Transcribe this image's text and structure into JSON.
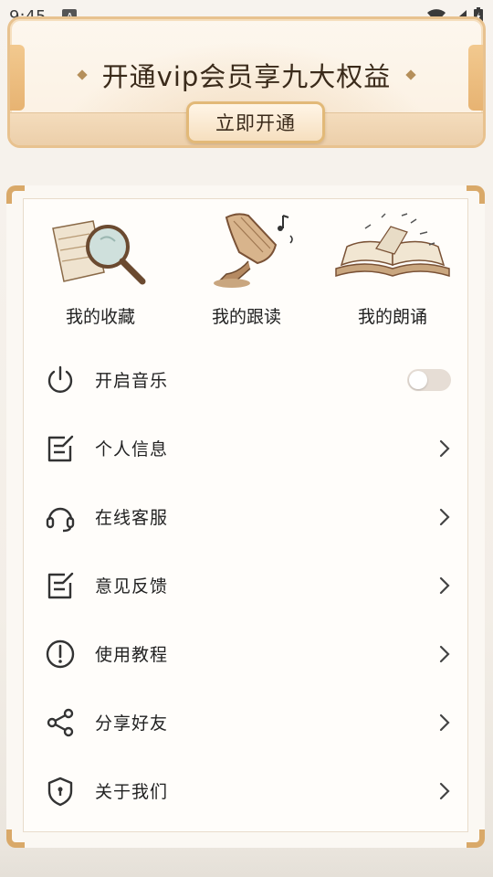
{
  "status": {
    "time": "9:45",
    "a_badge": "A"
  },
  "banner": {
    "title": "开通vip会员享九大权益",
    "button": "立即开通"
  },
  "features": [
    {
      "label": "我的收藏",
      "icon": "magnifier-map-icon"
    },
    {
      "label": "我的跟读",
      "icon": "gramophone-icon"
    },
    {
      "label": "我的朗诵",
      "icon": "open-book-icon"
    }
  ],
  "menu": [
    {
      "label": "开启音乐",
      "icon": "power-icon",
      "control": "toggle",
      "toggle_on": false
    },
    {
      "label": "个人信息",
      "icon": "edit-note-icon",
      "control": "chevron"
    },
    {
      "label": "在线客服",
      "icon": "headset-icon",
      "control": "chevron"
    },
    {
      "label": "意见反馈",
      "icon": "edit-note-icon",
      "control": "chevron"
    },
    {
      "label": "使用教程",
      "icon": "info-circle-icon",
      "control": "chevron"
    },
    {
      "label": "分享好友",
      "icon": "share-icon",
      "control": "chevron"
    },
    {
      "label": "关于我们",
      "icon": "shield-icon",
      "control": "chevron"
    }
  ],
  "colors": {
    "accent": "#e2b978",
    "text": "#222222",
    "icon": "#333333"
  }
}
